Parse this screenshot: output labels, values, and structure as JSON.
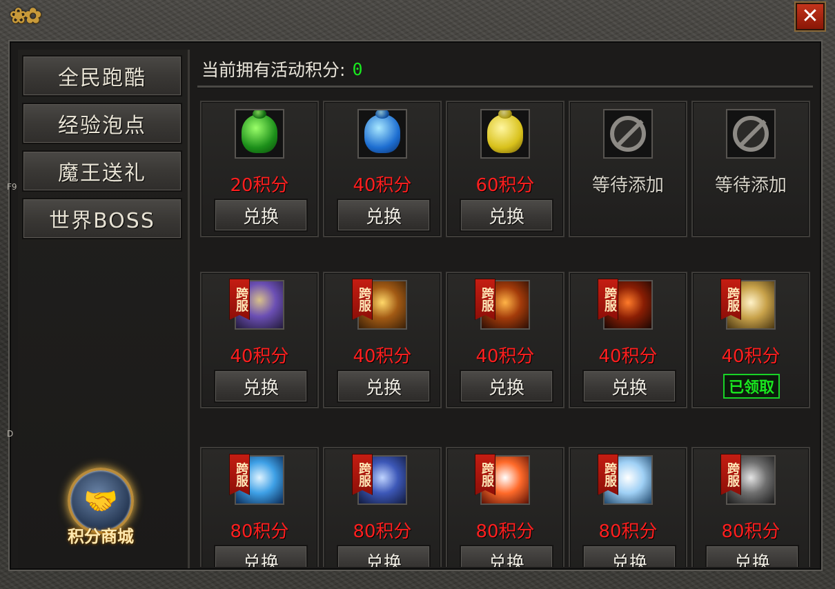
{
  "window": {
    "close_glyph": "✕"
  },
  "edge_labels": {
    "f9": "F9",
    "d": "D"
  },
  "sidebar": {
    "items": [
      {
        "label": "全民跑酷"
      },
      {
        "label": "经验泡点"
      },
      {
        "label": "魔王送礼"
      },
      {
        "label": "世界BOSS"
      }
    ],
    "mall_label": "积分商城"
  },
  "header": {
    "points_label": "当前拥有活动积分:",
    "points_value": "0"
  },
  "shop": {
    "badge_text": "跨服",
    "rows": [
      [
        {
          "icon": "green-bag-icon",
          "cost": "20积分",
          "action": "兑换"
        },
        {
          "icon": "blue-bag-icon",
          "cost": "40积分",
          "action": "兑换"
        },
        {
          "icon": "gold-bag-icon",
          "cost": "60积分",
          "action": "兑换"
        },
        {
          "icon": "empty-slot-icon",
          "cost": "等待添加"
        },
        {
          "icon": "empty-slot-icon",
          "cost": "等待添加"
        }
      ],
      [
        {
          "icon": "hero-icon",
          "cost": "40积分",
          "action": "兑换"
        },
        {
          "icon": "hero-icon",
          "cost": "40积分",
          "action": "兑换"
        },
        {
          "icon": "hero-icon",
          "cost": "40积分",
          "action": "兑换"
        },
        {
          "icon": "hero-icon",
          "cost": "40积分",
          "action": "兑换"
        },
        {
          "icon": "hero-icon",
          "cost": "40积分",
          "status": "已领取"
        }
      ],
      [
        {
          "icon": "hero-icon",
          "cost": "80积分",
          "action": "兑换"
        },
        {
          "icon": "hero-icon",
          "cost": "80积分",
          "action": "兑换"
        },
        {
          "icon": "hero-icon",
          "cost": "80积分",
          "action": "兑换"
        },
        {
          "icon": "hero-icon",
          "cost": "80积分",
          "action": "兑换"
        },
        {
          "icon": "hero-icon",
          "cost": "80积分",
          "action": "兑换"
        }
      ]
    ]
  },
  "colors": {
    "cost_red": "#ff1f1f",
    "points_green": "#19e81f",
    "close_red": "#c4341c"
  }
}
